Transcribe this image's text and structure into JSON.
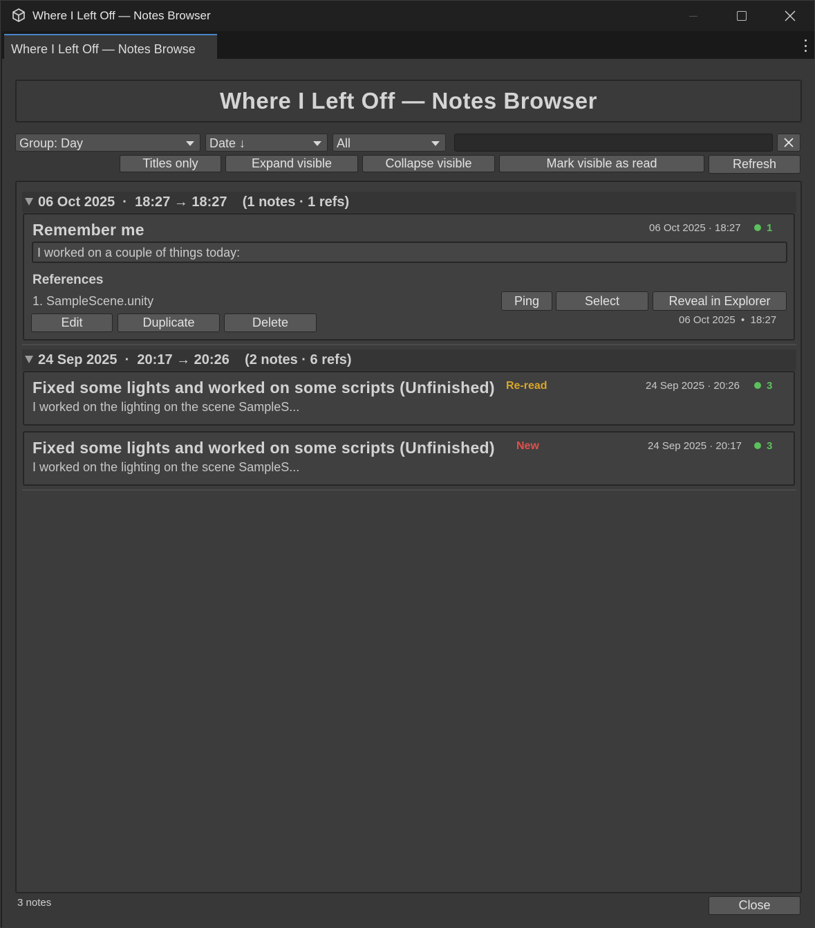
{
  "window": {
    "title": "Where I Left Off — Notes Browser",
    "tab_label": "Where I Left Off — Notes Browse"
  },
  "header": {
    "title": "Where I Left Off — Notes Browser"
  },
  "toolbar": {
    "group_select": "Group: Day",
    "sort_select": "Date ↓",
    "filter_select": "All",
    "search_value": "",
    "buttons": {
      "titles_only": "Titles only",
      "expand_visible": "Expand visible",
      "collapse_visible": "Collapse visible",
      "mark_visible_read": "Mark visible as read",
      "refresh": "Refresh"
    }
  },
  "groups": [
    {
      "header": "06 Oct 2025  ·  18:27 → 18:27    (1 notes · 1 refs)",
      "notes": [
        {
          "title": "Remember me",
          "meta": "06 Oct 2025 · 18:27",
          "ref_count": "1",
          "body": "I worked on a couple of things today:",
          "references_label": "References",
          "references": [
            {
              "name": "1. SampleScene.unity",
              "ping": "Ping",
              "select": "Select",
              "reveal": "Reveal in Explorer",
              "timestamp": "06 Oct 2025  •  18:27"
            }
          ],
          "actions": {
            "edit": "Edit",
            "duplicate": "Duplicate",
            "delete": "Delete"
          }
        }
      ]
    },
    {
      "header": "24 Sep 2025  ·  20:17 → 20:26    (2 notes · 6 refs)",
      "notes": [
        {
          "title": "Fixed some lights and worked on some scripts (Unfinished)",
          "badge": "Re-read",
          "badge_color": "#d8a62a",
          "meta": "24 Sep 2025 · 20:26",
          "ref_count": "3",
          "preview": "I worked on the lighting on the scene SampleS..."
        },
        {
          "title": "Fixed some lights and worked on some scripts (Unfinished)",
          "badge": "New",
          "badge_color": "#e0504a",
          "meta": "24 Sep 2025 · 20:17",
          "ref_count": "3",
          "preview": "I worked on the lighting on the scene SampleS..."
        }
      ]
    }
  ],
  "footer": {
    "count": "3 notes",
    "close": "Close"
  },
  "colors": {
    "accent_tab": "#4a86c8",
    "ref_dot": "#5cc05c"
  }
}
